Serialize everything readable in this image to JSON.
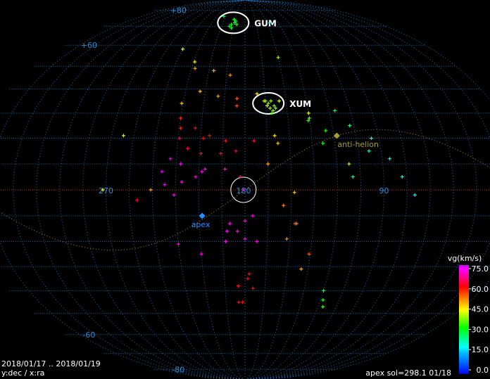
{
  "footer": {
    "date_range": "2018/01/17 .. 2018/01/19",
    "axes_note": "y:dec / x:ra",
    "apex_note": "apex sol=298.1 01/18"
  },
  "chart_data": {
    "type": "scatter",
    "projection": "mollweide",
    "x_axis": "ra (deg)",
    "y_axis": "dec (deg)",
    "x_center": 180,
    "x_range": [
      0,
      360
    ],
    "y_range": [
      -90,
      90
    ],
    "grid": true,
    "colors": {
      "grid": "#1e6aa8",
      "axis_labels": "#2a8fd8",
      "ecliptic": "#a08a2a",
      "antihelion": "#a8a02a",
      "apex": "#1e90ff",
      "circle": "#ffffff",
      "equator": "#cc3030"
    },
    "ra_labels": [
      {
        "ra": 270,
        "text": "270"
      },
      {
        "ra": 180,
        "text": "180"
      },
      {
        "ra": 90,
        "text": "90"
      }
    ],
    "dec_labels": [
      {
        "dec": 80,
        "text": "+80"
      },
      {
        "dec": 60,
        "text": "+60"
      },
      {
        "dec": -60,
        "text": "-60"
      },
      {
        "dec": -80,
        "text": "-80"
      }
    ],
    "markers": [
      {
        "name": "anti-helion",
        "label": "anti-helion",
        "ra": 118,
        "dec": 21,
        "shape": "diamond",
        "color": "#a8a02a"
      },
      {
        "name": "apex",
        "label": "apex",
        "ra": 208,
        "dec": -10,
        "shape": "diamond",
        "color": "#1e90ff"
      }
    ],
    "showers": [
      {
        "code": "GUM",
        "ra": 196,
        "dec": 72,
        "label_pos": "right"
      },
      {
        "code": "XUM",
        "ra": 163,
        "dec": 34,
        "label_pos": "right"
      },
      {
        "code": "",
        "ra": 181,
        "dec": 0,
        "label_pos": "none"
      }
    ],
    "colorbar": {
      "title": "vg(km/s)",
      "min": 0,
      "max": 75,
      "ticks": [
        "75.0",
        "60.0",
        "45.0",
        "30.0",
        "15.0",
        "0.0"
      ]
    },
    "meteors": [
      [
        196,
        74,
        33
      ],
      [
        194,
        72,
        30
      ],
      [
        198,
        71,
        32
      ],
      [
        200,
        70,
        31
      ],
      [
        193,
        73,
        29
      ],
      [
        197,
        69,
        30
      ],
      [
        191,
        71,
        34
      ],
      [
        165,
        35,
        40
      ],
      [
        163,
        34,
        38
      ],
      [
        161,
        35,
        39
      ],
      [
        164,
        33,
        41
      ],
      [
        162,
        32,
        40
      ],
      [
        159,
        33,
        37
      ],
      [
        160,
        31,
        39
      ],
      [
        158,
        32,
        38
      ],
      [
        166,
        35,
        40
      ],
      [
        161,
        30,
        36
      ],
      [
        214,
        76,
        26
      ],
      [
        146,
        72,
        18
      ],
      [
        240,
        58,
        42
      ],
      [
        224,
        52,
        46
      ],
      [
        222,
        49,
        50
      ],
      [
        206,
        48,
        50
      ],
      [
        192,
        46,
        52
      ],
      [
        150,
        54,
        40
      ],
      [
        214,
        39,
        48
      ],
      [
        200,
        37,
        50
      ],
      [
        186,
        36,
        55
      ],
      [
        186,
        33,
        56
      ],
      [
        171,
        38,
        46
      ],
      [
        155,
        35,
        42
      ],
      [
        226,
        34,
        48
      ],
      [
        225,
        28,
        58
      ],
      [
        224,
        24,
        58
      ],
      [
        214,
        24,
        62
      ],
      [
        208,
        20,
        60
      ],
      [
        204,
        21,
        60
      ],
      [
        193,
        19,
        62
      ],
      [
        224,
        20,
        65
      ],
      [
        218,
        16,
        62
      ],
      [
        209,
        14,
        64
      ],
      [
        196,
        14,
        62
      ],
      [
        186,
        15,
        63
      ],
      [
        174,
        19,
        64
      ],
      [
        158,
        18,
        48
      ],
      [
        160,
        21,
        46
      ],
      [
        135,
        30,
        43
      ],
      [
        136,
        27,
        35
      ],
      [
        135,
        28,
        36
      ],
      [
        125,
        23,
        33
      ],
      [
        128,
        18,
        32
      ],
      [
        116,
        31,
        30
      ],
      [
        108,
        25,
        25
      ],
      [
        95,
        20,
        20
      ],
      [
        98,
        15,
        22
      ],
      [
        85,
        12,
        18
      ],
      [
        112,
        10,
        40
      ],
      [
        165,
        10,
        50
      ],
      [
        183,
        5,
        65
      ],
      [
        229,
        12,
        74
      ],
      [
        222,
        10,
        72
      ],
      [
        208,
        7,
        72
      ],
      [
        206,
        8,
        72
      ],
      [
        193,
        8,
        70
      ],
      [
        234,
        7,
        74
      ],
      [
        221,
        3,
        72
      ],
      [
        212,
        5,
        72
      ],
      [
        181,
        0,
        72
      ],
      [
        232,
        2,
        74
      ],
      [
        226,
        -2,
        72
      ],
      [
        250,
        -4,
        62
      ],
      [
        241,
        0,
        50
      ],
      [
        262,
        21,
        42
      ],
      [
        272,
        0,
        44
      ],
      [
        148,
        -1,
        48
      ],
      [
        155,
        -6,
        52
      ],
      [
        146,
        -13,
        53
      ],
      [
        147,
        -13,
        54
      ],
      [
        152,
        -19,
        52
      ],
      [
        175,
        -10,
        72
      ],
      [
        180,
        -12,
        72
      ],
      [
        190,
        -13,
        72
      ],
      [
        192,
        -16,
        72
      ],
      [
        185,
        -16,
        72
      ],
      [
        180,
        -19,
        72
      ],
      [
        172,
        -20,
        72
      ],
      [
        193,
        -20,
        72
      ],
      [
        225,
        -21,
        72
      ],
      [
        210,
        -25,
        72
      ],
      [
        177,
        -33,
        62
      ],
      [
        178,
        -35,
        60
      ],
      [
        174,
        -39,
        60
      ],
      [
        185,
        -38,
        60
      ],
      [
        185,
        -45,
        60
      ],
      [
        182,
        -45,
        60
      ],
      [
        116,
        -47,
        35
      ],
      [
        118,
        -44,
        33
      ],
      [
        120,
        -40,
        30
      ],
      [
        140,
        -31,
        50
      ],
      [
        136,
        -25,
        55
      ],
      [
        110,
        5,
        25
      ],
      [
        78,
        5,
        20
      ],
      [
        70,
        -2,
        18
      ]
    ]
  }
}
